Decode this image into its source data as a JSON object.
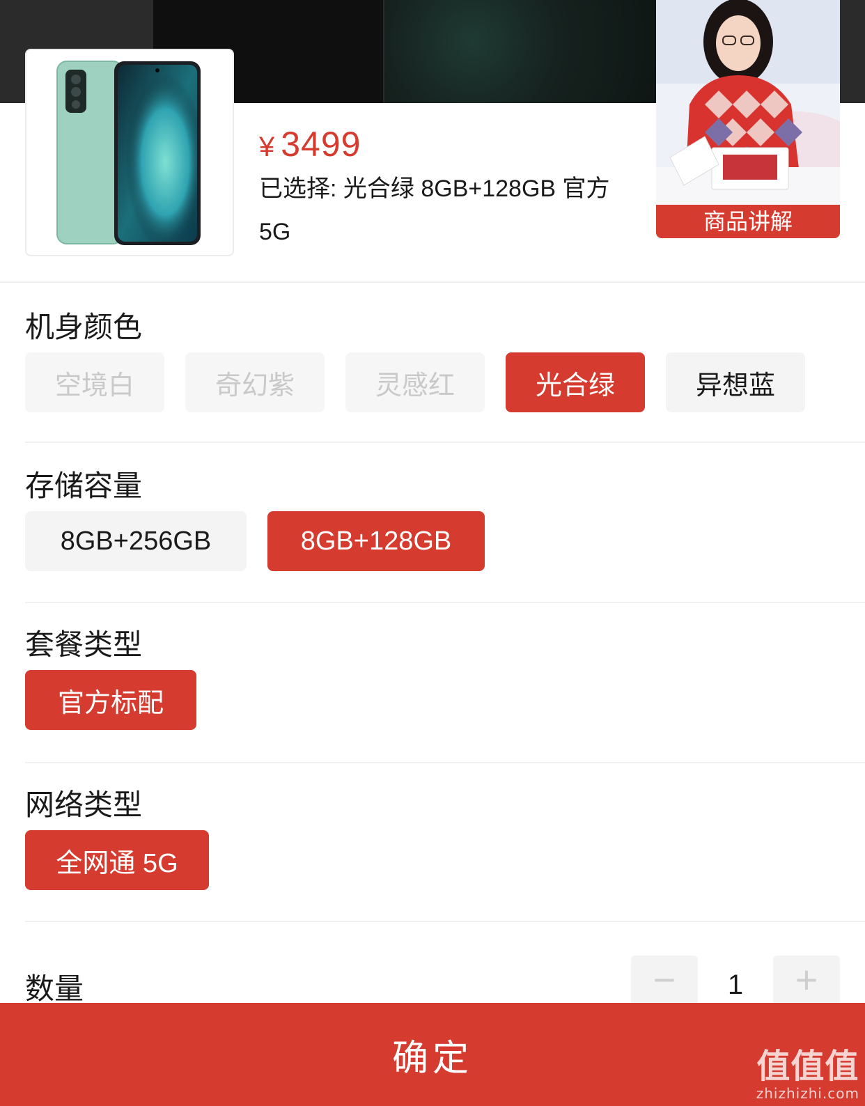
{
  "product": {
    "currency": "¥",
    "price": "3499",
    "selected_line1": "已选择: 光合绿 8GB+128GB 官方",
    "selected_line2": "5G"
  },
  "live": {
    "label": "商品讲解"
  },
  "sections": {
    "color": {
      "title": "机身颜色",
      "options": [
        "空境白",
        "奇幻紫",
        "灵感红",
        "光合绿",
        "异想蓝"
      ]
    },
    "storage": {
      "title": "存储容量",
      "options": [
        "8GB+256GB",
        "8GB+128GB"
      ]
    },
    "package": {
      "title": "套餐类型",
      "options": [
        "官方标配"
      ]
    },
    "network": {
      "title": "网络类型",
      "options": [
        "全网通 5G"
      ]
    },
    "quantity": {
      "title": "数量",
      "value": "1",
      "minus": "−",
      "plus": "+"
    }
  },
  "confirm_label": "确定",
  "watermark": {
    "main": "值值值",
    "sub": "zhizhizhi.com"
  },
  "colors": {
    "accent": "#d63b2f",
    "chip_bg": "#f4f4f4",
    "disabled_text": "#c9c9c9"
  }
}
